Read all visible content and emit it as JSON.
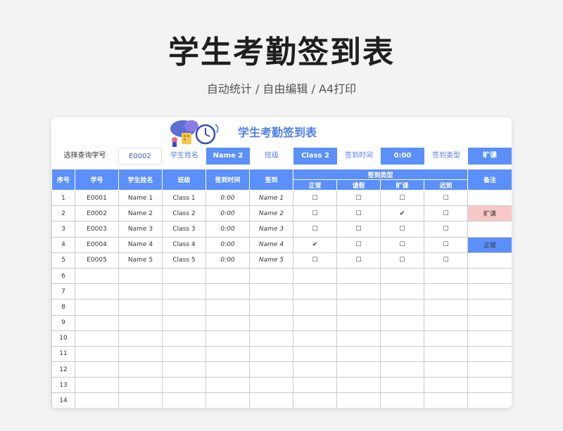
{
  "page": {
    "title": "学生考勤签到表",
    "subtitle": "自动统计 / 自由编辑 / A4打印"
  },
  "sheet": {
    "title": "学生考勤签到表",
    "query": {
      "select_label": "选择查询学号",
      "select_value": "E0002",
      "name_label": "学生姓名",
      "name_value": "Name 2",
      "class_label": "班级",
      "class_value": "Class 2",
      "time_label": "签到时间",
      "time_value": "0:00",
      "type_label": "签到类型",
      "type_value": "旷课"
    },
    "headers": {
      "seq": "序号",
      "id": "学号",
      "name": "学生姓名",
      "class": "班级",
      "time": "签到时间",
      "sign": "签到",
      "type_group": "签到类型",
      "normal": "正常",
      "leave": "请假",
      "absent": "旷课",
      "late": "迟到",
      "note": "备注"
    },
    "rows": [
      {
        "seq": "1",
        "id": "E0001",
        "name": "Name 1",
        "class": "Class 1",
        "time": "0:00",
        "sign": "Name 1",
        "normal": "☐",
        "leave": "☐",
        "absent": "☐",
        "late": "☐",
        "note": ""
      },
      {
        "seq": "2",
        "id": "E0002",
        "name": "Name 2",
        "class": "Class 2",
        "time": "0:00",
        "sign": "Name 2",
        "normal": "☐",
        "leave": "☐",
        "absent": "✔",
        "late": "☐",
        "note": "旷课"
      },
      {
        "seq": "3",
        "id": "E0003",
        "name": "Name 3",
        "class": "Class 3",
        "time": "0:00",
        "sign": "Name 3",
        "normal": "☐",
        "leave": "☐",
        "absent": "☐",
        "late": "☐",
        "note": ""
      },
      {
        "seq": "4",
        "id": "E0004",
        "name": "Name 4",
        "class": "Class 4",
        "time": "0:00",
        "sign": "Name 4",
        "normal": "✔",
        "leave": "☐",
        "absent": "☐",
        "late": "☐",
        "note": "正常"
      },
      {
        "seq": "5",
        "id": "E0005",
        "name": "Name 5",
        "class": "Class 5",
        "time": "0:00",
        "sign": "Name 5",
        "normal": "☐",
        "leave": "☐",
        "absent": "☐",
        "late": "☐",
        "note": ""
      },
      {
        "seq": "6"
      },
      {
        "seq": "7"
      },
      {
        "seq": "8"
      },
      {
        "seq": "9"
      },
      {
        "seq": "10"
      },
      {
        "seq": "11"
      },
      {
        "seq": "12"
      },
      {
        "seq": "13"
      },
      {
        "seq": "14"
      }
    ]
  },
  "colors": {
    "accent": "#5b8ff9",
    "title_blue": "#4f7ff0",
    "absent_note_bg": "#f8c8c8",
    "normal_note_bg": "#5b8ff9"
  }
}
